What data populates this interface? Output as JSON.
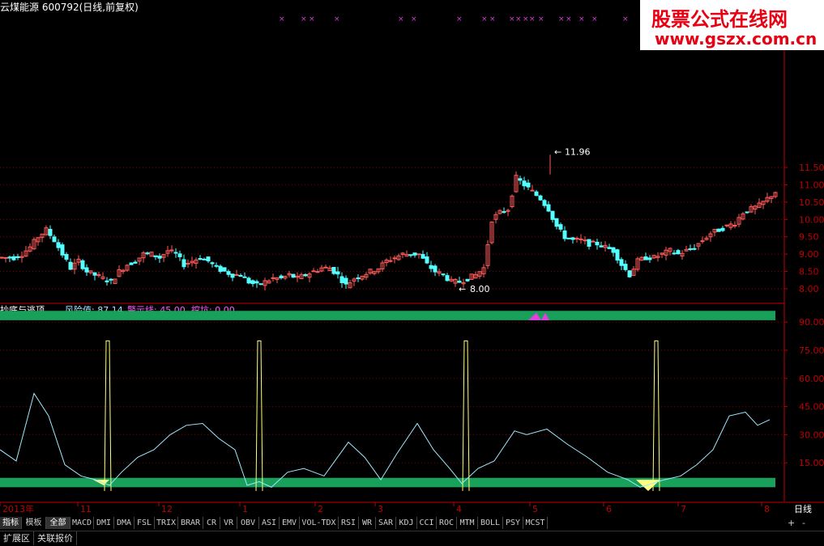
{
  "header": {
    "stock_title": "云煤能源 600792(日线,前复权)"
  },
  "watermark": {
    "line1": "股票公式在线网",
    "line2": "www.gszx.com.cn"
  },
  "price_panel": {
    "y_ticks": [
      "11.50",
      "11.00",
      "10.50",
      "10.00",
      "9.50",
      "9.00",
      "8.50",
      "8.00"
    ],
    "high_label": "11.96",
    "low_label": "8.00",
    "marker_glyph": "××"
  },
  "indicator_panel": {
    "title": "抄底与逃顶",
    "risk_label": "风险值: 87.14",
    "warn_label": "警示线: 45.00",
    "dig_label": "挖坑: 0.00",
    "y_ticks": [
      "90.00",
      "75.00",
      "60.00",
      "45.00",
      "30.00",
      "15.00"
    ]
  },
  "time_axis": {
    "labels": [
      "2013年",
      "11",
      "12",
      "1",
      "2",
      "3",
      "4",
      "5",
      "6",
      "7",
      "8"
    ],
    "period_label": "日线"
  },
  "tabs": {
    "items": [
      "指标",
      "模板",
      "全部",
      "MACD",
      "DMI",
      "DMA",
      "FSL",
      "TRIX",
      "BRAR",
      "CR",
      "VR",
      "OBV",
      "ASI",
      "EMV",
      "VOL-TDX",
      "RSI",
      "WR",
      "SAR",
      "KDJ",
      "CCI",
      "ROC",
      "MTM",
      "BOLL",
      "PSY",
      "MCST"
    ],
    "active_index": 0,
    "selected_index": 2
  },
  "bottom": {
    "items": [
      "扩展区",
      "关联报价"
    ],
    "plus": "+",
    "minus": "-"
  },
  "colors": {
    "up": "#ff5a5a",
    "down": "#54ffff",
    "axis": "#c00000",
    "grid": "#8a0000",
    "band": "#19a05a",
    "risk_line": "#9fe8ff",
    "spike": "#ffff80",
    "marker": "#d040d0"
  },
  "chart_data": [
    {
      "type": "candlestick",
      "title": "云煤能源 600792(日线,前复权)",
      "ylim": [
        7.9,
        11.9
      ],
      "y_ticks": [
        8.0,
        8.5,
        9.0,
        9.5,
        10.0,
        10.5,
        11.0,
        11.5
      ],
      "annotations": [
        {
          "text": "11.96",
          "value": 11.96,
          "x": "5"
        },
        {
          "text": "8.00",
          "value": 8.0,
          "x": "4"
        }
      ],
      "series": [
        {
          "name": "close",
          "x_positions": [
            0,
            10,
            20,
            30,
            40,
            50,
            60,
            70,
            80,
            90,
            100,
            110,
            120,
            130,
            140,
            150,
            160,
            170,
            180,
            190,
            200,
            210,
            220,
            230,
            240,
            250,
            260,
            270,
            280,
            290,
            300,
            310,
            320,
            330,
            340,
            350,
            360,
            370,
            380,
            390,
            400,
            410,
            420,
            430,
            440,
            450,
            460,
            470,
            480,
            490,
            500,
            510,
            520,
            530,
            540,
            550,
            560,
            570,
            580,
            590,
            600,
            610,
            620,
            630,
            640,
            650,
            660,
            670,
            680,
            690,
            700,
            710,
            720,
            730,
            740,
            750,
            760,
            770,
            780,
            790,
            800,
            810,
            820,
            830,
            840,
            850,
            860,
            870,
            880,
            890,
            900,
            910,
            920,
            930,
            940,
            950
          ],
          "values": [
            8.9,
            8.9,
            9.0,
            9.2,
            9.5,
            9.7,
            9.4,
            9.0,
            8.6,
            8.8,
            8.5,
            8.4,
            8.3,
            8.2,
            8.5,
            8.7,
            8.8,
            9.0,
            9.0,
            8.9,
            9.1,
            9.0,
            8.7,
            8.8,
            8.9,
            8.8,
            8.6,
            8.5,
            8.4,
            8.4,
            8.2,
            8.1,
            8.2,
            8.3,
            8.3,
            8.4,
            8.3,
            8.4,
            8.5,
            8.6,
            8.6,
            8.4,
            8.1,
            8.3,
            8.4,
            8.5,
            8.6,
            8.8,
            8.9,
            9.0,
            9.0,
            9.0,
            8.7,
            8.5,
            8.4,
            8.2,
            8.2,
            8.3,
            8.4,
            8.6,
            10.0,
            10.2,
            10.3,
            11.2,
            11.0,
            10.8,
            10.6,
            10.3,
            9.8,
            9.5,
            9.4,
            9.4,
            9.3,
            9.3,
            9.2,
            9.1,
            8.7,
            8.4,
            8.8,
            8.9,
            8.9,
            9.0,
            9.1,
            9.0,
            9.1,
            9.2,
            9.4,
            9.6,
            9.7,
            9.8,
            9.9,
            10.2,
            10.3,
            10.4,
            10.6,
            10.8
          ]
        }
      ]
    },
    {
      "type": "line",
      "title": "抄底与逃顶",
      "ylim": [
        0,
        100
      ],
      "y_ticks": [
        15,
        30,
        45,
        60,
        75,
        90
      ],
      "bands": [
        90,
        5
      ],
      "series": [
        {
          "name": "风险值",
          "x_positions": [
            0,
            20,
            42,
            60,
            80,
            100,
            118,
            135,
            150,
            170,
            190,
            210,
            230,
            250,
            270,
            290,
            305,
            320,
            335,
            355,
            375,
            400,
            430,
            450,
            470,
            490,
            515,
            535,
            555,
            570,
            590,
            610,
            635,
            650,
            675,
            700,
            725,
            750,
            775,
            790,
            805,
            820,
            840,
            860,
            880,
            900,
            920,
            935,
            950
          ],
          "values": [
            22,
            16,
            52,
            40,
            14,
            8,
            6,
            3,
            10,
            18,
            22,
            30,
            35,
            36,
            28,
            22,
            3,
            5,
            2,
            10,
            12,
            8,
            26,
            18,
            6,
            20,
            36,
            22,
            12,
            4,
            12,
            16,
            32,
            30,
            33,
            25,
            18,
            10,
            6,
            2,
            4,
            6,
            8,
            14,
            22,
            40,
            42,
            35,
            38
          ]
        },
        {
          "name": "spike",
          "positions": [
            135,
            322,
            577,
            812
          ],
          "values": [
            80,
            80,
            80,
            80
          ]
        }
      ]
    }
  ]
}
